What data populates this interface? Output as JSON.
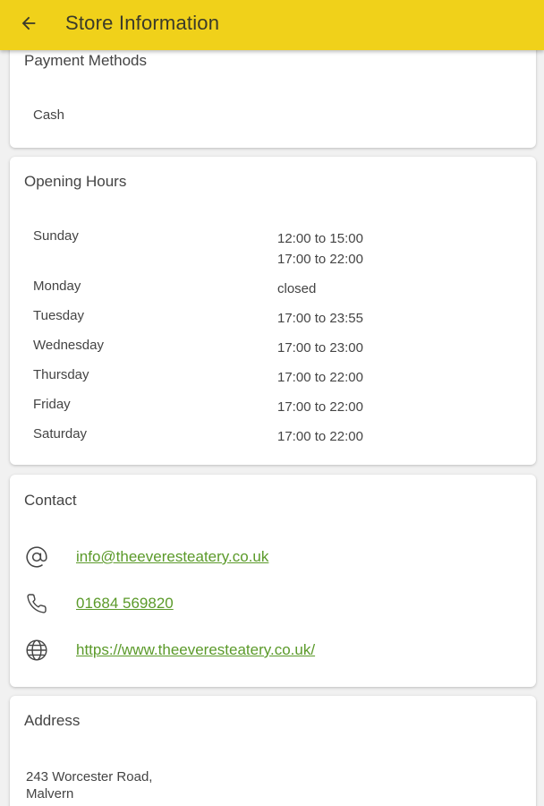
{
  "header": {
    "title": "Store Information"
  },
  "payment": {
    "title": "Payment Methods",
    "methods": [
      "Cash"
    ]
  },
  "hours": {
    "title": "Opening Hours",
    "rows": [
      {
        "day": "Sunday",
        "times": [
          "12:00 to 15:00",
          "17:00 to 22:00"
        ]
      },
      {
        "day": "Monday",
        "times": [
          "closed"
        ]
      },
      {
        "day": "Tuesday",
        "times": [
          "17:00 to 23:55"
        ]
      },
      {
        "day": "Wednesday",
        "times": [
          "17:00 to 23:00"
        ]
      },
      {
        "day": "Thursday",
        "times": [
          "17:00 to 22:00"
        ]
      },
      {
        "day": "Friday",
        "times": [
          "17:00 to 22:00"
        ]
      },
      {
        "day": "Saturday",
        "times": [
          "17:00 to 22:00"
        ]
      }
    ]
  },
  "contact": {
    "title": "Contact",
    "email": "info@theeveresteatery.co.uk",
    "phone": "01684 569820",
    "website": "https://www.theeveresteatery.co.uk/"
  },
  "address": {
    "title": "Address",
    "line1": "243 Worcester Road,",
    "line2": "Malvern"
  },
  "icons": {
    "back": "arrow-left-icon",
    "email": "at-sign-icon",
    "phone": "phone-icon",
    "web": "globe-icon"
  },
  "colors": {
    "appbar": "#f0d11a",
    "link": "#5b9a2a",
    "background": "#f1f1f1"
  }
}
